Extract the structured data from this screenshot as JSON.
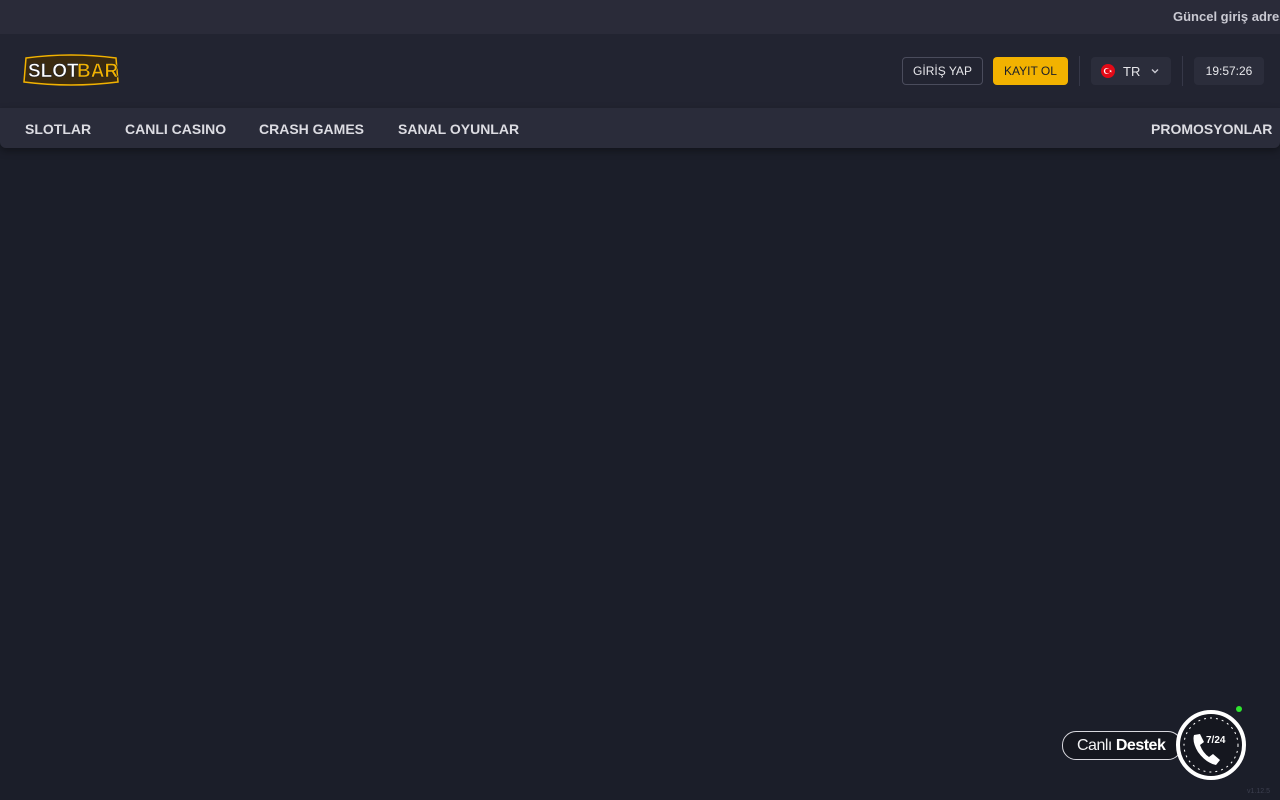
{
  "ticker": {
    "text": "Güncel giriş adresi"
  },
  "header": {
    "logo": {
      "part1": "SLOT",
      "part2": "BAR"
    },
    "login_label": "GİRİŞ YAP",
    "register_label": "KAYIT OL",
    "language": {
      "code": "TR",
      "icon": "turkey-flag-icon"
    },
    "clock": "19:57:26"
  },
  "nav": {
    "items": [
      {
        "label": "SLOTLAR"
      },
      {
        "label": "CANLI CASINO"
      },
      {
        "label": "CRASH GAMES"
      },
      {
        "label": "SANAL OYUNLAR"
      }
    ],
    "right_item": {
      "label": "PROMOSYONLAR"
    }
  },
  "support": {
    "label_light": "Canlı",
    "label_bold": "Destek",
    "icon_text": "7/24",
    "icon": "phone-24-7-icon"
  },
  "version": "v1.12.5",
  "colors": {
    "background": "#1b1e29",
    "header": "#222431",
    "nav": "#2a2c3a",
    "accent": "#f2b200",
    "online": "#2ee62e"
  }
}
